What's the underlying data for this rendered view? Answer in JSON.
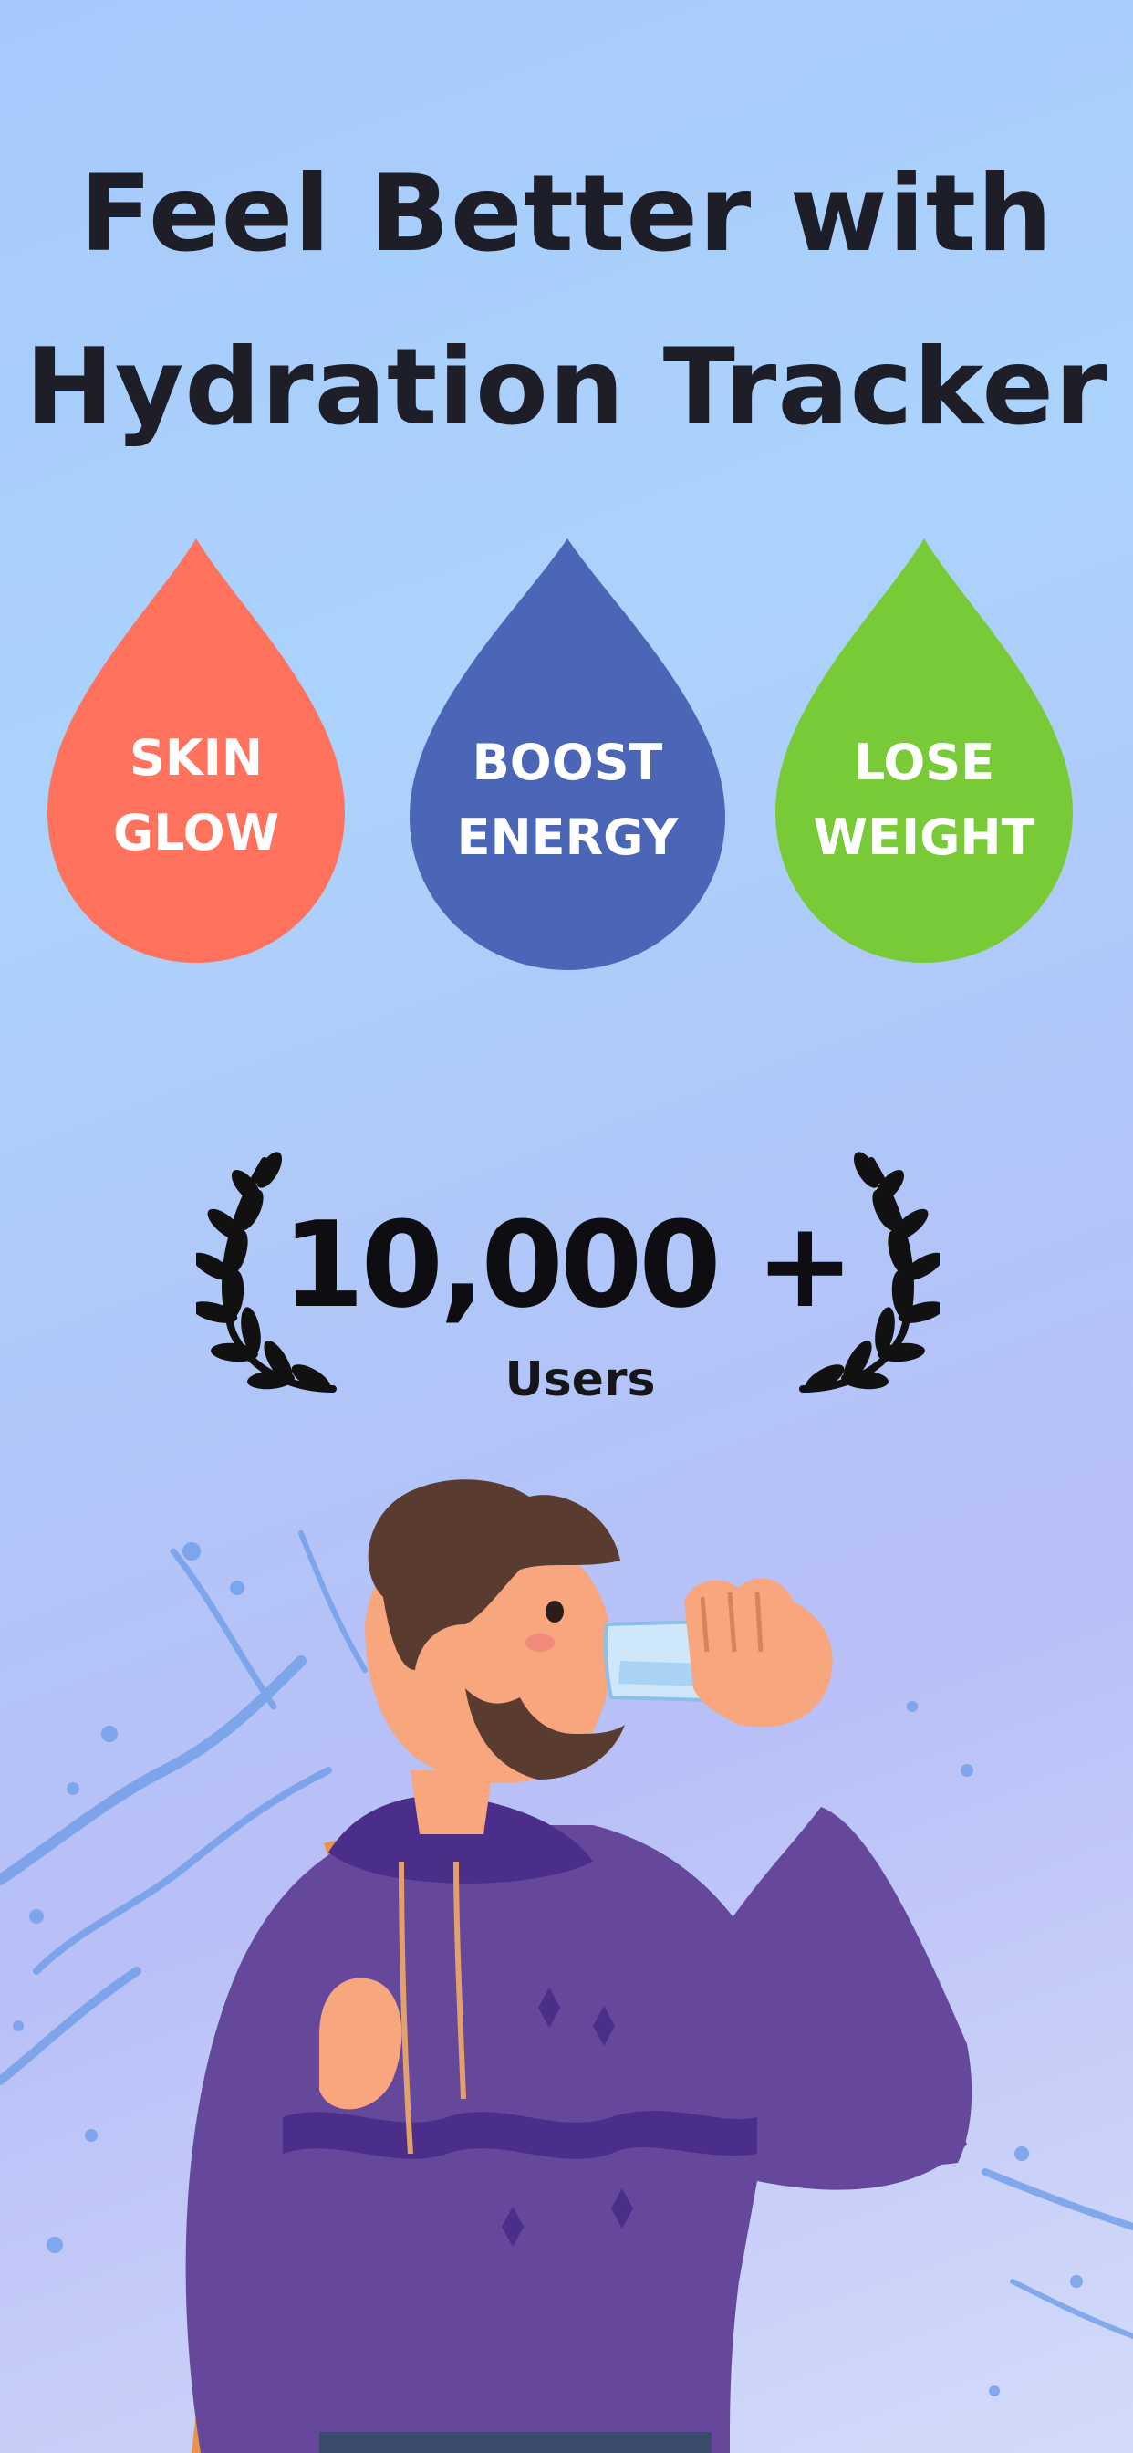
{
  "headline": {
    "line1": "Feel Better with",
    "line2": "Hydration Tracker"
  },
  "benefits": [
    {
      "line1": "SKIN",
      "line2": "GLOW",
      "color": "#ff735e"
    },
    {
      "line1": "BOOST",
      "line2": "ENERGY",
      "color": "#4b66b7"
    },
    {
      "line1": "LOSE",
      "line2": "WEIGHT",
      "color": "#78cb36"
    }
  ],
  "stats": {
    "count": "10,000 +",
    "label": "Users"
  },
  "colors": {
    "background_top": "#a6c9fb",
    "background_bottom": "#d3dbfa",
    "hoodie": "#65489b",
    "text": "#1e1e28"
  },
  "icons": {
    "laurel_left": "laurel-wreath-left-icon",
    "laurel_right": "laurel-wreath-right-icon"
  }
}
